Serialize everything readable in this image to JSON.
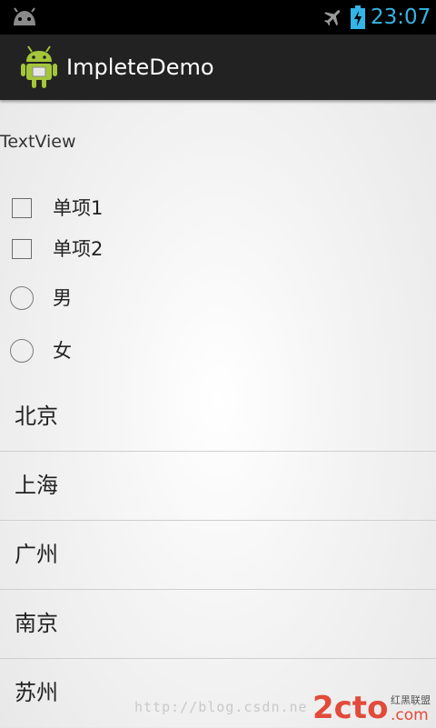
{
  "status_bar": {
    "time": "23:07",
    "accent_color": "#33b5e5",
    "icons": [
      "android-debug-icon",
      "airplane-mode-icon",
      "battery-charging-icon"
    ]
  },
  "action_bar": {
    "title": "ImpleteDemo",
    "icon": "android-app-icon"
  },
  "content": {
    "textview": "TextView",
    "checkboxes": [
      {
        "label": "单项1",
        "checked": false
      },
      {
        "label": "单项2",
        "checked": false
      }
    ],
    "radios": [
      {
        "label": "男",
        "selected": false
      },
      {
        "label": "女",
        "selected": false
      }
    ],
    "list": [
      "北京",
      "上海",
      "广州",
      "南京",
      "苏州"
    ]
  },
  "watermark": {
    "url": "http://blog.csdn.ne",
    "logo_text": "2cto",
    "logo_domain": ".com",
    "logo_subtitle": "红黑联盟"
  }
}
